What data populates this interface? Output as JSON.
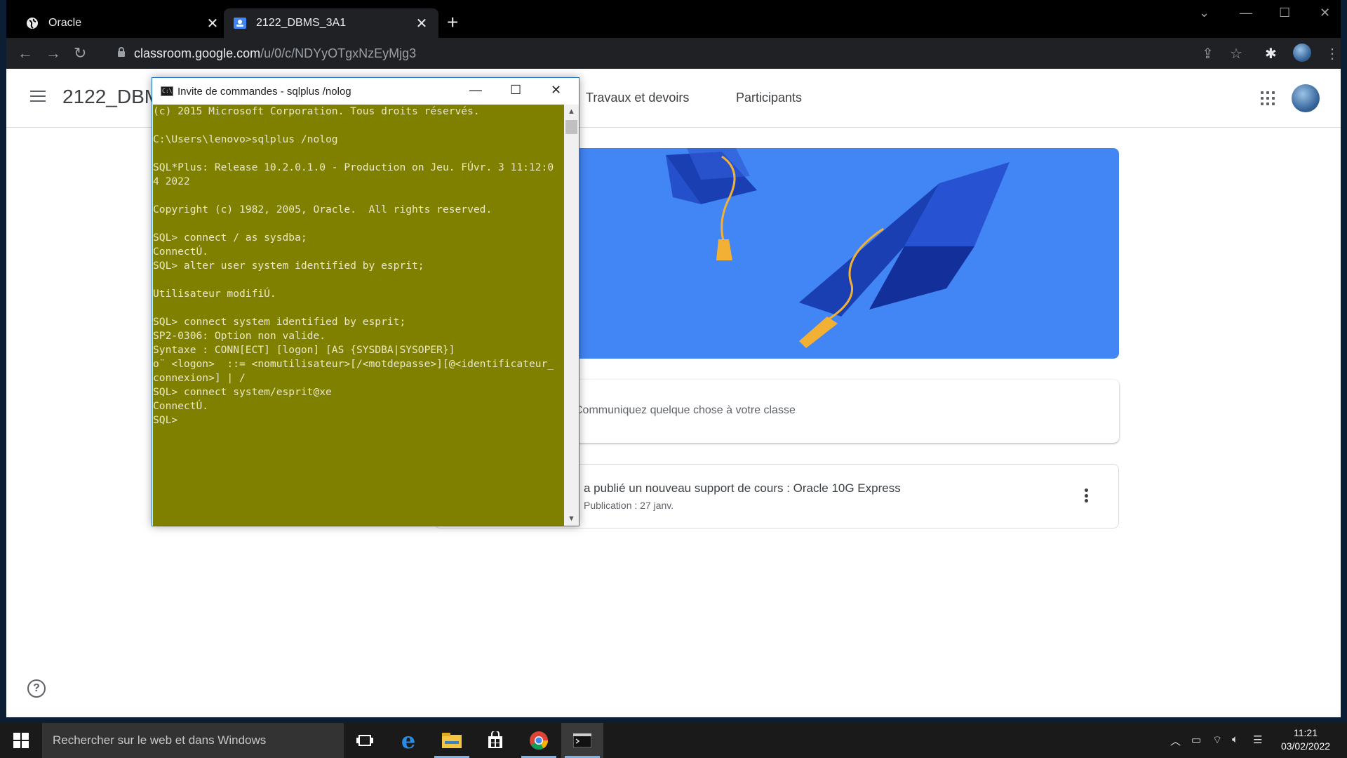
{
  "browser": {
    "tabs": [
      {
        "title": "Oracle",
        "icon": "globe-icon"
      },
      {
        "title": "2122_DBMS_3A1",
        "icon": "classroom-icon"
      }
    ],
    "url_host": "classroom.google.com",
    "url_path": "/u/0/c/NDYyOTgxNzEyMjg3"
  },
  "classroom": {
    "class_title": "2122_DBMS_3A1",
    "tabs": [
      "Travaux et devoirs",
      "Participants"
    ],
    "share_placeholder": "Communiquez quelque chose à votre classe",
    "post_title": "a publié un nouveau support de cours : Oracle 10G Express",
    "post_date": "Publication : 27 janv.",
    "banner_color": "#4285f4"
  },
  "cmd": {
    "title": "Invite de commandes - sqlplus  /nolog",
    "background": "#808000",
    "lines": [
      "(c) 2015 Microsoft Corporation. Tous droits réservés.",
      "",
      "C:\\Users\\lenovo>sqlplus /nolog",
      "",
      "SQL*Plus: Release 10.2.0.1.0 - Production on Jeu. FÚvr. 3 11:12:0",
      "4 2022",
      "",
      "Copyright (c) 1982, 2005, Oracle.  All rights reserved.",
      "",
      "SQL> connect / as sysdba;",
      "ConnectÚ.",
      "SQL> alter user system identified by esprit;",
      "",
      "Utilisateur modifiÚ.",
      "",
      "SQL> connect system identified by esprit;",
      "SP2-0306: Option non valide.",
      "Syntaxe : CONN[ECT] [logon] [AS {SYSDBA|SYSOPER}]",
      "o¨ <logon>  ::= <nomutilisateur>[/<motdepasse>][@<identificateur_",
      "connexion>] | /",
      "SQL> connect system/esprit@xe",
      "ConnectÚ.",
      "SQL>"
    ]
  },
  "taskbar": {
    "search_placeholder": "Rechercher sur le web et dans Windows",
    "time": "11:21",
    "date": "03/02/2022"
  }
}
